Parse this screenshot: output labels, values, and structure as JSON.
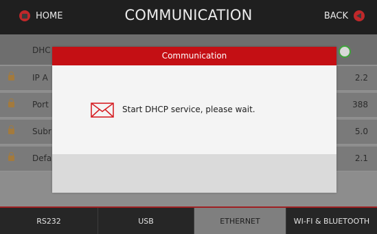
{
  "header": {
    "home_label": "HOME",
    "title": "COMMUNICATION",
    "back_label": "BACK"
  },
  "settings": {
    "dhcp_label": "DHC",
    "rows": [
      {
        "label": "IP A",
        "value": "2.2"
      },
      {
        "label": "Port",
        "value": "388"
      },
      {
        "label": "Subr",
        "value": "5.0"
      },
      {
        "label": "Defa",
        "value": "2.1"
      }
    ]
  },
  "dialog": {
    "title": "Communication",
    "message": "Start DHCP service, please wait.",
    "icon": "mail-icon"
  },
  "tabs": [
    {
      "label": "RS232"
    },
    {
      "label": "USB"
    },
    {
      "label": "ETHERNET",
      "active": true
    },
    {
      "label": "WI-FI & BLUETOOTH"
    }
  ],
  "colors": {
    "accent_red": "#c40f14",
    "toggle_green": "#3ea43a"
  }
}
